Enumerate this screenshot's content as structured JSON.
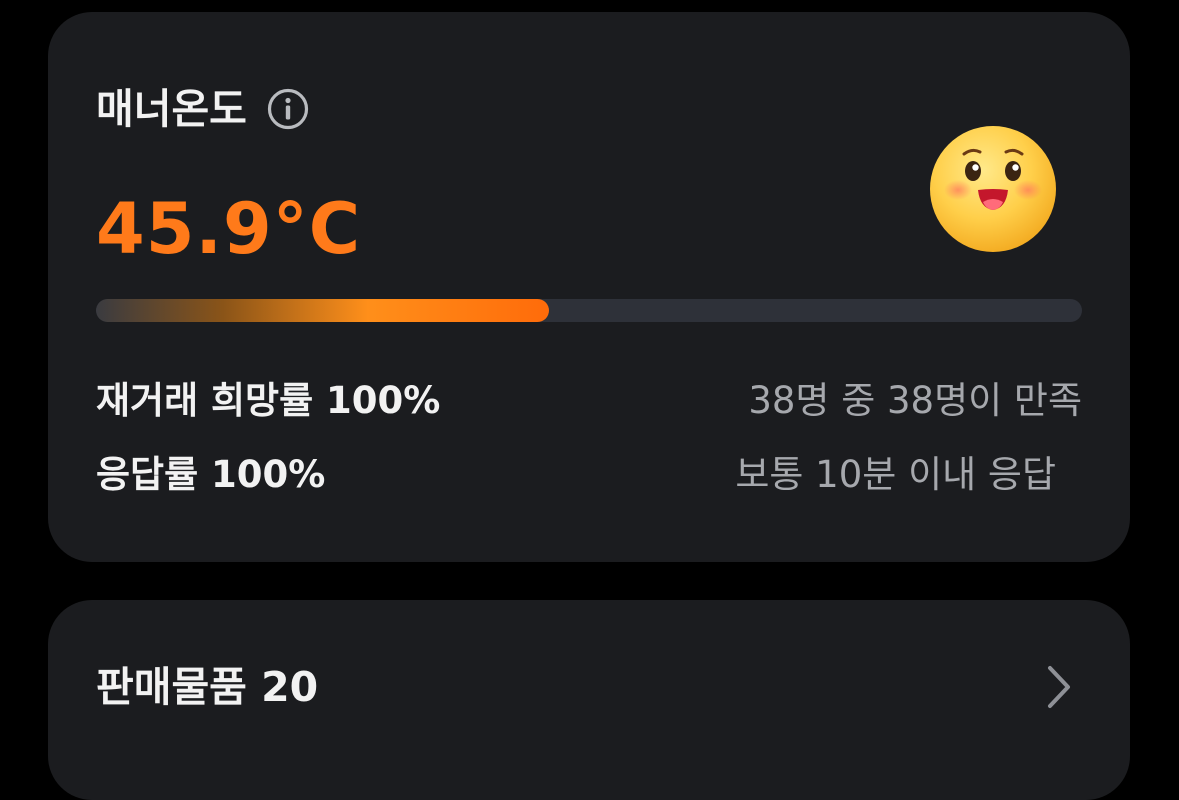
{
  "manner": {
    "title": "매너온도",
    "info_icon": "info-circle-icon",
    "temperature": "45.9°C",
    "emoji_icon": "smiling-face-icon",
    "progress_fraction": 0.459,
    "accent_color": "#ff7a1a",
    "rehire_label": "재거래 희망률 100%",
    "rehire_detail": "38명 중 38명이 만족",
    "response_label": "응답률 100%",
    "response_detail": "보통 10분 이내 응답"
  },
  "sales": {
    "title": "판매물품 20",
    "chevron_icon": "chevron-right-icon"
  }
}
